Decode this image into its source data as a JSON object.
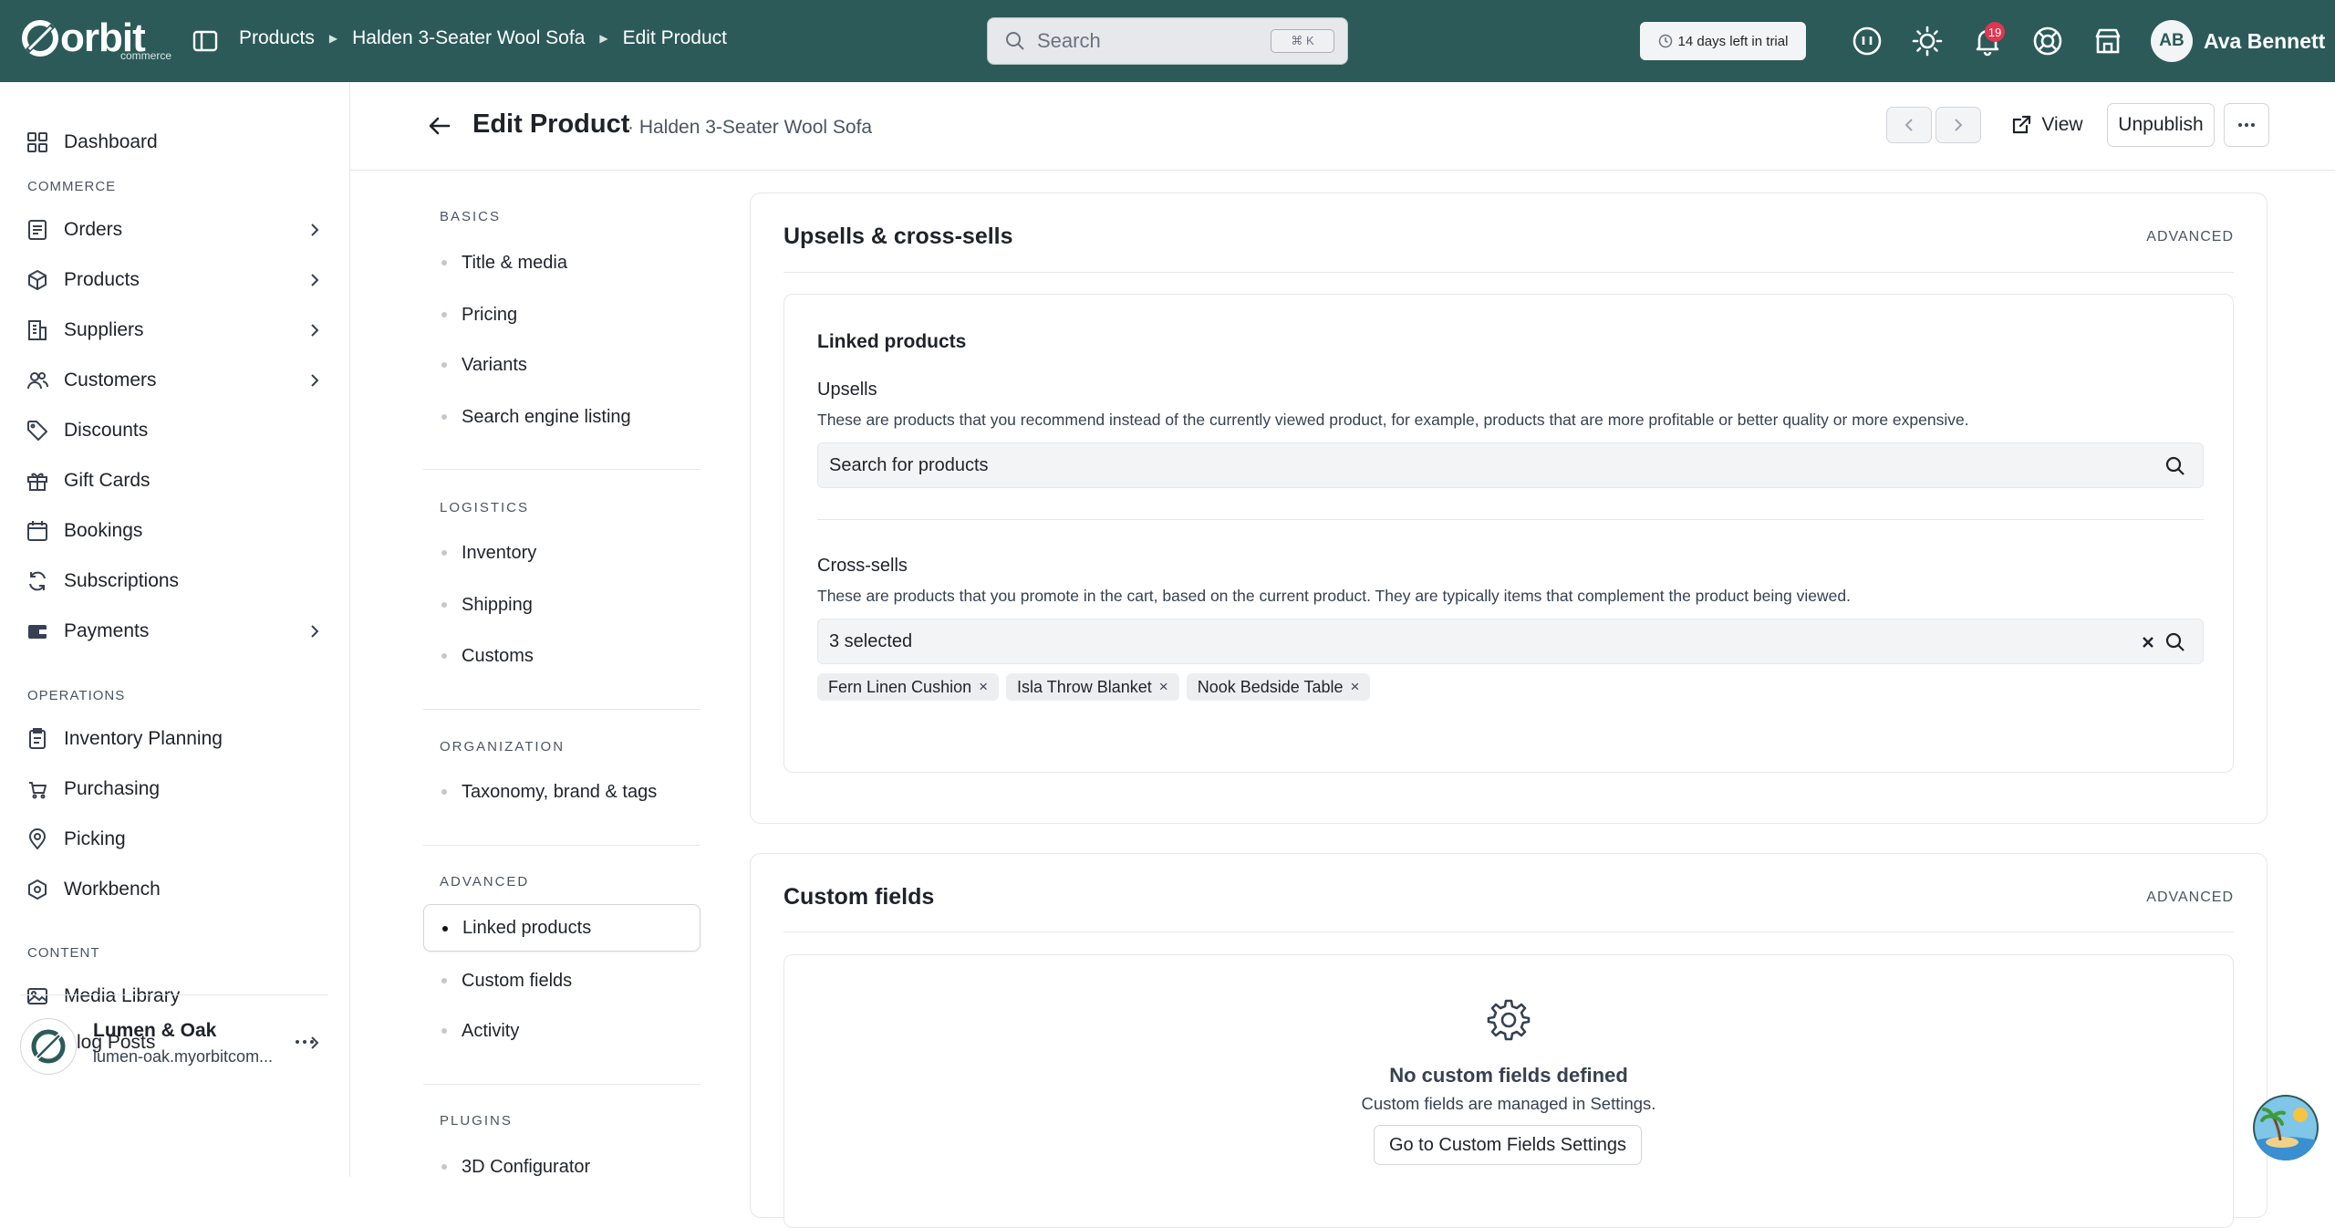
{
  "topbar": {
    "logo": "orbit",
    "logo_sub": "commerce",
    "breadcrumbs": [
      "Products",
      "Halden 3-Seater Wool Sofa",
      "Edit Product"
    ],
    "search_placeholder": "Search",
    "search_shortcut": "⌘ K",
    "trial_text": "14 days left in trial",
    "notifications_count": "19",
    "user_initials": "AB",
    "user_name": "Ava Bennett"
  },
  "sidebar": {
    "items_top": [
      {
        "label": "Dashboard",
        "icon": "dashboard-icon"
      }
    ],
    "sections": [
      {
        "title": "COMMERCE",
        "items": [
          {
            "label": "Orders",
            "icon": "orders-icon",
            "chevron": true
          },
          {
            "label": "Products",
            "icon": "box-icon",
            "chevron": true
          },
          {
            "label": "Suppliers",
            "icon": "building-icon",
            "chevron": true
          },
          {
            "label": "Customers",
            "icon": "users-icon",
            "chevron": true
          },
          {
            "label": "Discounts",
            "icon": "tag-icon",
            "chevron": false
          },
          {
            "label": "Gift Cards",
            "icon": "gift-icon",
            "chevron": false
          },
          {
            "label": "Bookings",
            "icon": "calendar-icon",
            "chevron": false
          },
          {
            "label": "Subscriptions",
            "icon": "refresh-icon",
            "chevron": false
          },
          {
            "label": "Payments",
            "icon": "wallet-icon",
            "chevron": true
          }
        ]
      },
      {
        "title": "OPERATIONS",
        "items": [
          {
            "label": "Inventory Planning",
            "icon": "clipboard-icon"
          },
          {
            "label": "Purchasing",
            "icon": "cart-icon"
          },
          {
            "label": "Picking",
            "icon": "pin-icon"
          },
          {
            "label": "Workbench",
            "icon": "tool-icon"
          }
        ]
      },
      {
        "title": "CONTENT",
        "items": [
          {
            "label": "Media Library",
            "icon": "image-icon",
            "chevron": false
          },
          {
            "label": "Blog Posts",
            "icon": "document-icon",
            "chevron": true
          }
        ]
      }
    ],
    "store": {
      "name": "Lumen & Oak",
      "url": "lumen-oak.myorbitcom..."
    }
  },
  "header": {
    "title": "Edit Product",
    "subtitle": "· Halden 3-Seater Wool Sofa",
    "view_label": "View",
    "unpublish_label": "Unpublish"
  },
  "subnav": {
    "sections": [
      {
        "title": "BASICS",
        "items": [
          "Title & media",
          "Pricing",
          "Variants",
          "Search engine listing"
        ]
      },
      {
        "title": "LOGISTICS",
        "items": [
          "Inventory",
          "Shipping",
          "Customs"
        ]
      },
      {
        "title": "ORGANIZATION",
        "items": [
          "Taxonomy, brand & tags"
        ]
      },
      {
        "title": "ADVANCED",
        "items": [
          "Linked products",
          "Custom fields",
          "Activity"
        ]
      },
      {
        "title": "PLUGINS",
        "items": [
          "3D Configurator"
        ]
      }
    ],
    "active": "Linked products"
  },
  "upsells_card": {
    "title": "Upsells & cross-sells",
    "tag": "ADVANCED",
    "inner_title": "Linked products",
    "upsells_label": "Upsells",
    "upsells_help": "These are products that you recommend instead of the currently viewed product, for example, products that are more profitable or better quality or more expensive.",
    "upsells_placeholder": "Search for products",
    "crosssells_label": "Cross-sells",
    "crosssells_help": "These are products that you promote in the cart, based on the current product. They are typically items that complement the product being viewed.",
    "crosssells_value": "3 selected",
    "chips": [
      "Fern Linen Cushion",
      "Isla Throw Blanket",
      "Nook Bedside Table"
    ]
  },
  "custom_fields_card": {
    "title": "Custom fields",
    "tag": "ADVANCED",
    "empty_title": "No custom fields defined",
    "empty_text": "Custom fields are managed in Settings.",
    "button_label": "Go to Custom Fields Settings"
  },
  "colors": {
    "topbar": "#2b5a59",
    "badge": "#e0364f"
  }
}
